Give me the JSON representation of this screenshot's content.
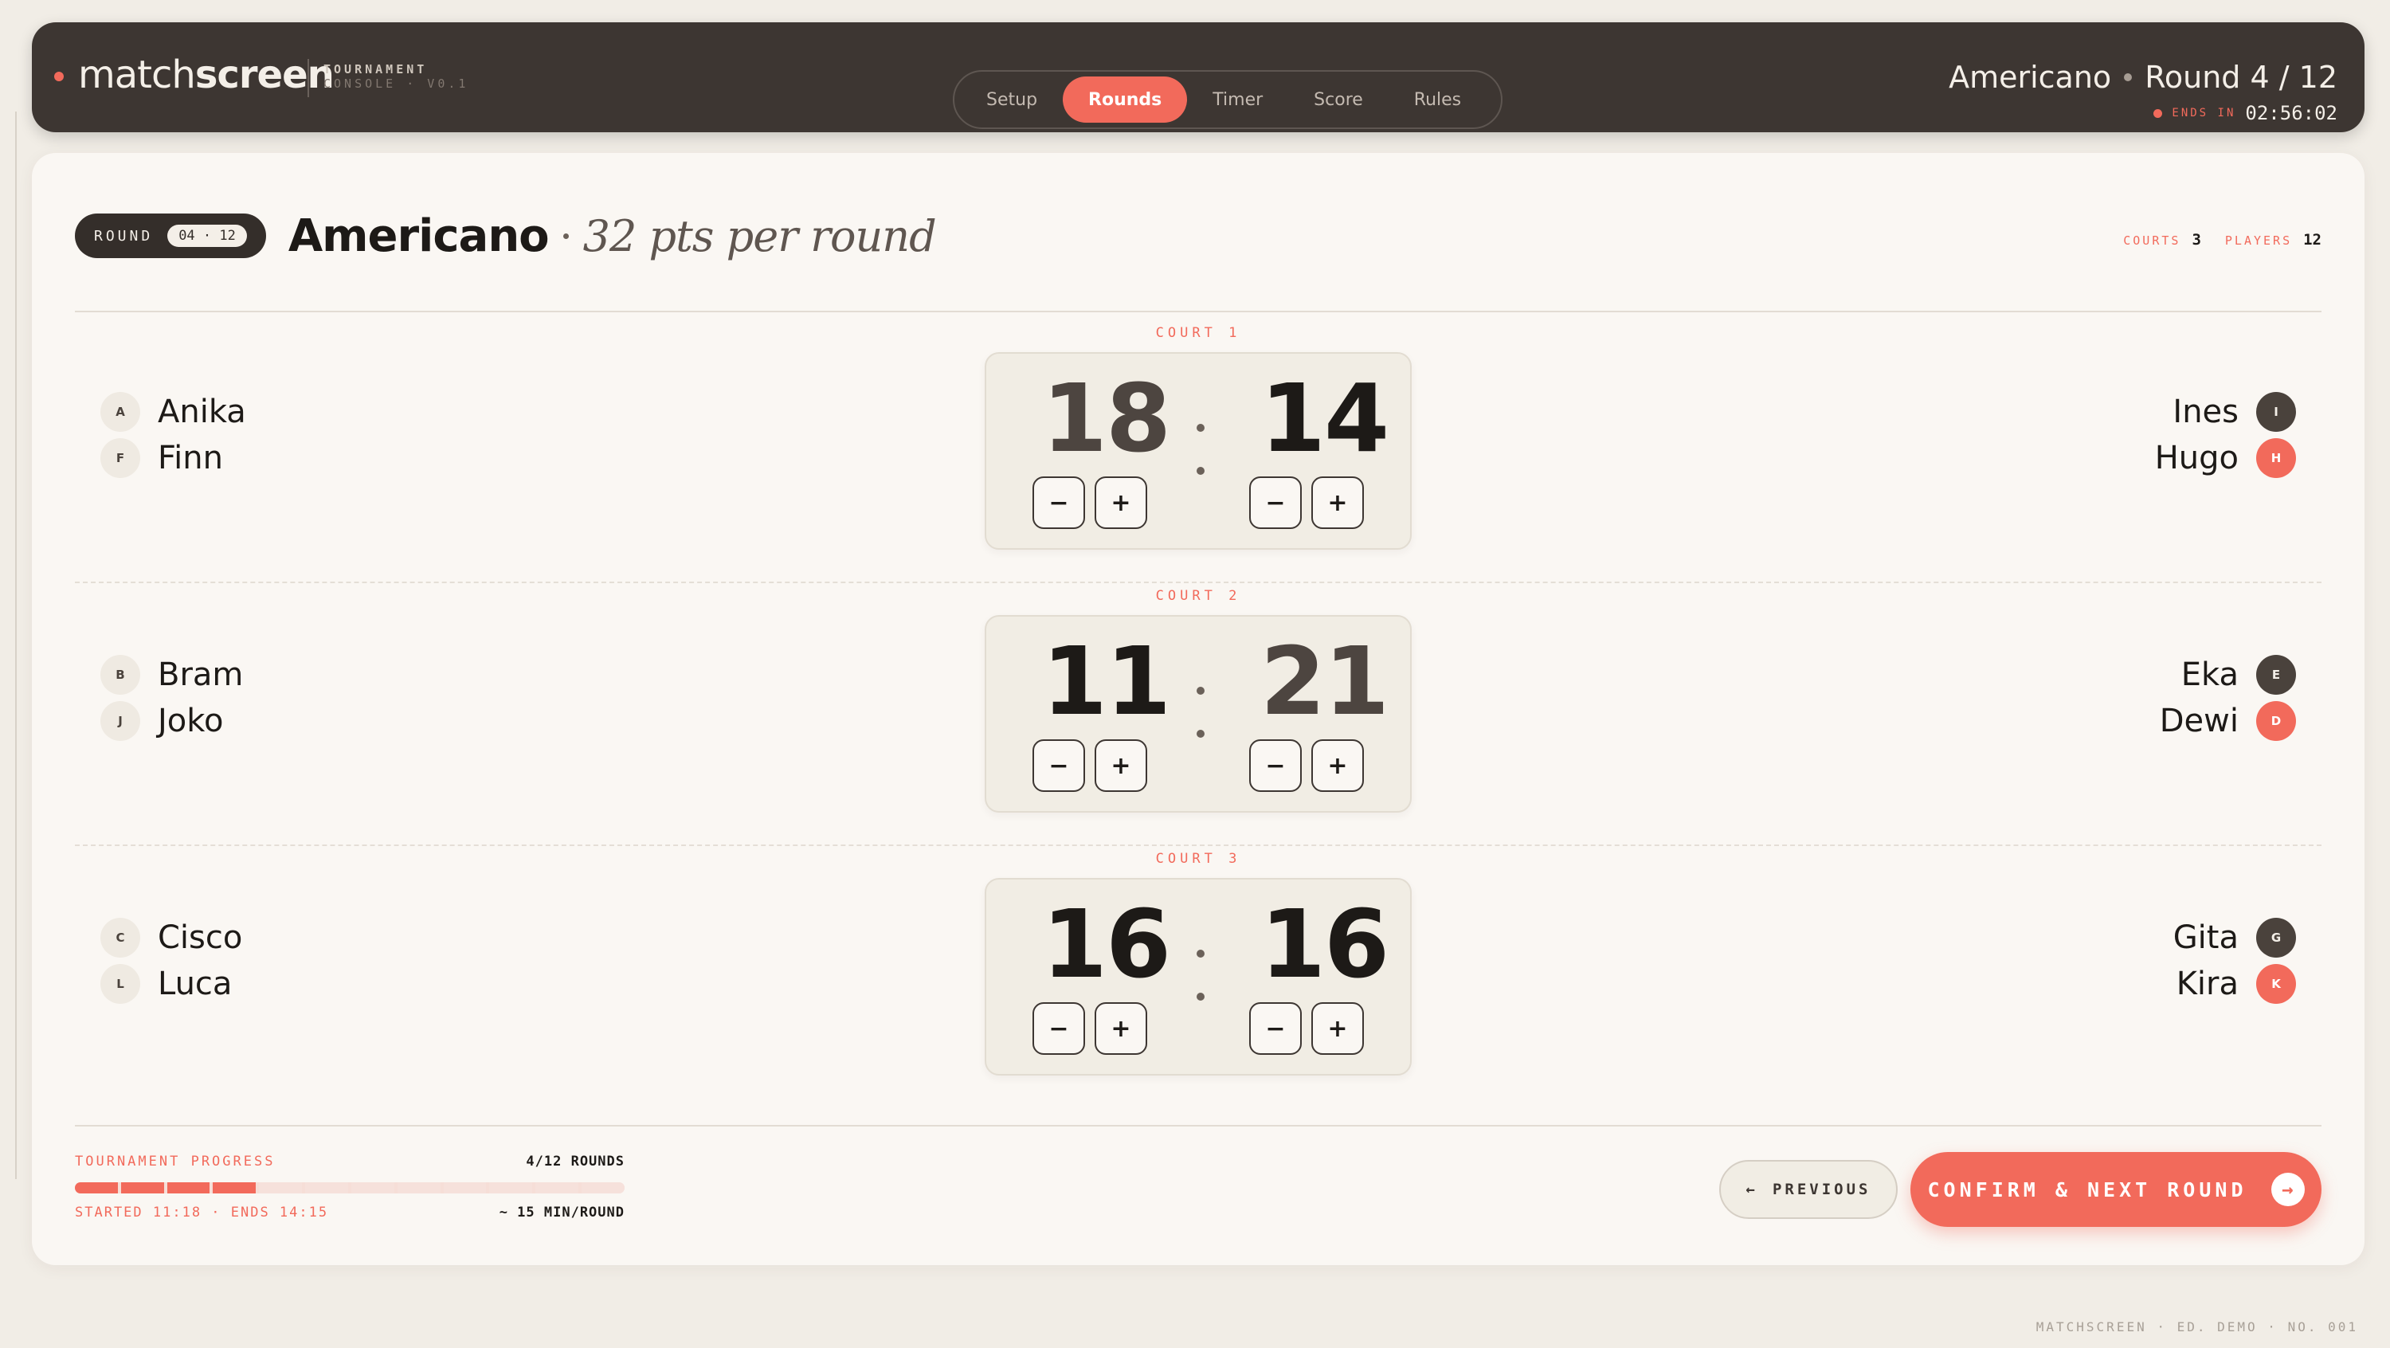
{
  "app": {
    "brand_light": "match",
    "brand_bold": "screen",
    "sub_line1": "TOURNAMENT",
    "sub_line2": "CONSOLE · V0.1"
  },
  "nav": {
    "tabs": [
      {
        "label": "Setup",
        "active": false
      },
      {
        "label": "Rounds",
        "active": true
      },
      {
        "label": "Timer",
        "active": false
      },
      {
        "label": "Score",
        "active": false
      },
      {
        "label": "Rules",
        "active": false
      }
    ]
  },
  "status": {
    "format": "Americano",
    "round": "Round 4 / 12",
    "ends_label": "ENDS IN",
    "ends_time": "02:56:02"
  },
  "header": {
    "round_label": "ROUND",
    "round_num": "04 · 12",
    "title": "Americano",
    "subtitle": "32 pts per round",
    "courts_label": "COURTS",
    "courts_val": "3",
    "players_label": "PLAYERS",
    "players_val": "12"
  },
  "courts": [
    {
      "label": "COURT 1",
      "left": [
        {
          "initial": "A",
          "name": "Anika"
        },
        {
          "initial": "F",
          "name": "Finn"
        }
      ],
      "right": [
        {
          "initial": "I",
          "name": "Ines"
        },
        {
          "initial": "H",
          "name": "Hugo"
        }
      ],
      "score_left": "18",
      "score_right": "14"
    },
    {
      "label": "COURT 2",
      "left": [
        {
          "initial": "B",
          "name": "Bram"
        },
        {
          "initial": "J",
          "name": "Joko"
        }
      ],
      "right": [
        {
          "initial": "E",
          "name": "Eka"
        },
        {
          "initial": "D",
          "name": "Dewi"
        }
      ],
      "score_left": "11",
      "score_right": "21"
    },
    {
      "label": "COURT 3",
      "left": [
        {
          "initial": "C",
          "name": "Cisco"
        },
        {
          "initial": "L",
          "name": "Luca"
        }
      ],
      "right": [
        {
          "initial": "G",
          "name": "Gita"
        },
        {
          "initial": "K",
          "name": "Kira"
        }
      ],
      "score_left": "16",
      "score_right": "16"
    }
  ],
  "controls": {
    "minus": "−",
    "plus": "+"
  },
  "progress": {
    "label": "TOURNAMENT PROGRESS",
    "count": "4/12 ROUNDS",
    "completed": 4,
    "total": 12,
    "started": "STARTED 11:18 · ENDS 14:15",
    "pace": "~ 15 MIN/ROUND"
  },
  "actions": {
    "prev_arrow": "←",
    "prev_label": "PREVIOUS",
    "next_label": "CONFIRM & NEXT ROUND",
    "next_arrow": "→"
  },
  "colophon": "MATCHSCREEN · ED. DEMO · NO. 001",
  "colors": {
    "accent": "#f26a5b",
    "dark": "#3d3632",
    "card": "#faf7f3",
    "background": "#f1ede6"
  },
  "icons": {
    "brand_dot": "status-dot-icon",
    "ends_dot": "live-dot-icon",
    "prev": "arrow-left-icon",
    "next": "arrow-right-icon"
  }
}
